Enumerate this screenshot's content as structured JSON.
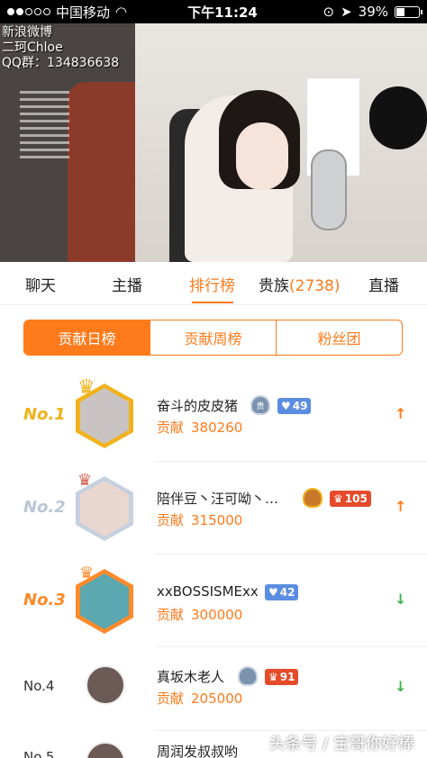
{
  "status_bar": {
    "carrier": "中国移动",
    "time": "下午11:24",
    "battery": "39%",
    "battery_level": 0.39,
    "signal_bars": 2
  },
  "video": {
    "overlay_lines": [
      "新浪微博",
      "二珂Chloe",
      "QQ群：134836638"
    ]
  },
  "tabs": [
    {
      "label": "聊天",
      "active": false
    },
    {
      "label": "主播",
      "active": false
    },
    {
      "label": "排行榜",
      "active": true
    },
    {
      "label": "贵族",
      "count": "(2738)",
      "active": false
    },
    {
      "label": "直播",
      "active": false
    }
  ],
  "segments": [
    {
      "label": "贡献日榜",
      "active": true
    },
    {
      "label": "贡献周榜",
      "active": false
    },
    {
      "label": "粉丝团",
      "active": false
    }
  ],
  "contrib_label": "贡献",
  "rankings": [
    {
      "rank": "No.1",
      "name": "奋斗的皮皮猪",
      "score": "380260",
      "badge_text": "贵",
      "level": "49",
      "trend": "up",
      "trend_icon": "↑"
    },
    {
      "rank": "No.2",
      "name": "陪伴豆丶汪可呦丶…",
      "score": "315000",
      "badge_text": "",
      "level": "105",
      "trend": "up",
      "trend_icon": "↑"
    },
    {
      "rank": "No.3",
      "name": "xxBOSSISMExx",
      "score": "300000",
      "badge_text": "",
      "level": "42",
      "trend": "down",
      "trend_icon": "↓"
    },
    {
      "rank": "No.4",
      "name": "真坂木老人",
      "score": "205000",
      "badge_text": "",
      "level": "91",
      "trend": "down",
      "trend_icon": "↓"
    },
    {
      "rank": "No.5",
      "name": "周润发叔叔哟",
      "score": "",
      "badge_text": "",
      "level": "",
      "trend": "",
      "trend_icon": ""
    }
  ],
  "watermark": "头条号 / 宝哥你好棒",
  "colors": {
    "accent": "#ff7a1a",
    "down": "#3fb34f",
    "gold": "#f0b21c"
  }
}
